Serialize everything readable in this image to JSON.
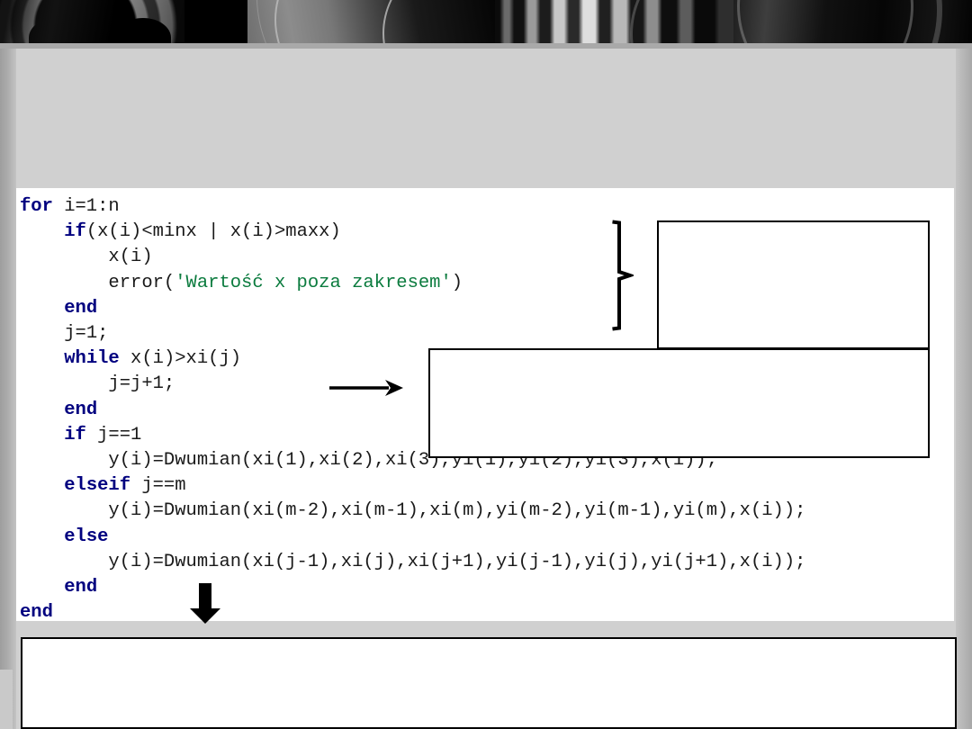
{
  "slide": {
    "background_color": "#d0d0d0",
    "header_band_color": "#050505"
  },
  "header": {
    "name": "decorative-photo-strip",
    "description": "Grayscale machinery photo strip",
    "panels": [
      {
        "name": "photo-panel-wheel-spokes"
      },
      {
        "name": "photo-panel-curved-disc"
      },
      {
        "name": "photo-panel-striations"
      },
      {
        "name": "photo-panel-dark-ring"
      }
    ]
  },
  "code_block": {
    "language": "MATLAB",
    "keyword_color": "#00007f",
    "string_color": "#0b7b3e",
    "text_color": "#1a1a1a",
    "background_color": "#ffffff",
    "lines": [
      {
        "indent": 0,
        "tokens": [
          {
            "t": "kw",
            "v": "for"
          },
          {
            "t": "pl",
            "v": " i=1:n"
          }
        ]
      },
      {
        "indent": 1,
        "tokens": [
          {
            "t": "kw",
            "v": "if"
          },
          {
            "t": "pl",
            "v": "(x(i)<minx | x(i)>maxx)"
          }
        ]
      },
      {
        "indent": 2,
        "tokens": [
          {
            "t": "pl",
            "v": "x(i)"
          }
        ]
      },
      {
        "indent": 2,
        "tokens": [
          {
            "t": "pl",
            "v": "error("
          },
          {
            "t": "str",
            "v": "'Wartość x poza zakresem'"
          },
          {
            "t": "pl",
            "v": ")"
          }
        ]
      },
      {
        "indent": 1,
        "tokens": [
          {
            "t": "kw",
            "v": "end"
          }
        ]
      },
      {
        "indent": 1,
        "tokens": [
          {
            "t": "pl",
            "v": "j=1;"
          }
        ]
      },
      {
        "indent": 1,
        "tokens": [
          {
            "t": "kw",
            "v": "while"
          },
          {
            "t": "pl",
            "v": " x(i)>xi(j)"
          }
        ]
      },
      {
        "indent": 2,
        "tokens": [
          {
            "t": "pl",
            "v": "j=j+1;"
          }
        ]
      },
      {
        "indent": 1,
        "tokens": [
          {
            "t": "kw",
            "v": "end"
          }
        ]
      },
      {
        "indent": 1,
        "tokens": [
          {
            "t": "kw",
            "v": "if"
          },
          {
            "t": "pl",
            "v": " j==1"
          }
        ]
      },
      {
        "indent": 2,
        "tokens": [
          {
            "t": "pl",
            "v": "y(i)=Dwumian(xi(1),xi(2),xi(3),yi(1),yi(2),yi(3),x(i));"
          }
        ]
      },
      {
        "indent": 1,
        "tokens": [
          {
            "t": "kw",
            "v": "elseif"
          },
          {
            "t": "pl",
            "v": " j==m"
          }
        ]
      },
      {
        "indent": 2,
        "tokens": [
          {
            "t": "pl",
            "v": "y(i)=Dwumian(xi(m-2),xi(m-1),xi(m),yi(m-2),yi(m-1),yi(m),x(i));"
          }
        ]
      },
      {
        "indent": 1,
        "tokens": [
          {
            "t": "kw",
            "v": "else"
          }
        ]
      },
      {
        "indent": 2,
        "tokens": [
          {
            "t": "pl",
            "v": "y(i)=Dwumian(xi(j-1),xi(j),xi(j+1),yi(j-1),yi(j),yi(j+1),x(i));"
          }
        ]
      },
      {
        "indent": 1,
        "tokens": [
          {
            "t": "kw",
            "v": "end"
          }
        ]
      },
      {
        "indent": 0,
        "tokens": [
          {
            "t": "kw",
            "v": "end"
          }
        ]
      }
    ]
  },
  "overlay_boxes": [
    {
      "name": "callout-box-top-right",
      "text": "",
      "border_color": "#000000",
      "fill_color": "#ffffff"
    },
    {
      "name": "callout-box-middle",
      "text": "",
      "border_color": "#000000",
      "fill_color": "#ffffff"
    },
    {
      "name": "callout-box-bottom",
      "text": "",
      "border_color": "#000000",
      "fill_color": "#ffffff"
    }
  ],
  "annotations": [
    {
      "name": "curly-brace-right",
      "glyph": "}",
      "color": "#000000"
    },
    {
      "name": "arrow-right-icon",
      "glyph": "→",
      "color": "#000000"
    },
    {
      "name": "arrow-down-icon",
      "glyph": "↓",
      "color": "#000000"
    }
  ]
}
